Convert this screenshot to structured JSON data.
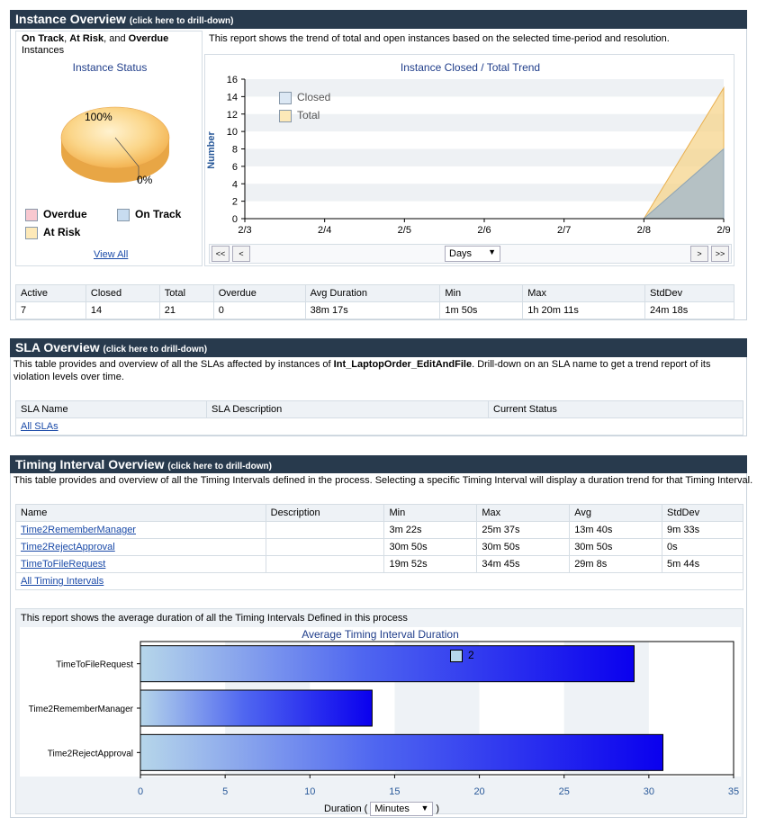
{
  "instance": {
    "header_title": "Instance Overview",
    "header_sub": "(click here to drill-down)",
    "left_title_part1": "On Track",
    "left_title_part2": ", ",
    "left_title_part3": "At Risk",
    "left_title_part4": ", and ",
    "left_title_part5": "Overdue",
    "left_title_part6": "Instances",
    "description": "This report shows the trend of total and open instances based on the selected time-period and resolution.",
    "status_chart_title": "Instance Status",
    "pie_label_100": "100%",
    "pie_label_0": "0%",
    "legend": [
      {
        "label": "Overdue",
        "color": "#f8c8d0"
      },
      {
        "label": "On Track",
        "color": "#c8dcf0"
      },
      {
        "label": "At Risk",
        "color": "#fde9b8"
      }
    ],
    "view_all": "View All",
    "trend_title": "Instance Closed / Total Trend",
    "trend_ylabel": "Number",
    "trend_legend_closed": "Closed",
    "trend_legend_total": "Total",
    "resolution": "Days",
    "nav": {
      "first": "<<",
      "prev": "<",
      "next": ">",
      "last": ">>"
    }
  },
  "chart_data": [
    {
      "type": "pie",
      "title": "Instance Status",
      "categories": [
        "Overdue",
        "On Track",
        "At Risk"
      ],
      "values": [
        0,
        0,
        100
      ],
      "labels": [
        "0%",
        "100%"
      ]
    },
    {
      "type": "area",
      "title": "Instance Closed / Total Trend",
      "ylabel": "Number",
      "x": [
        "2/3",
        "2/4",
        "2/5",
        "2/6",
        "2/7",
        "2/8",
        "2/9"
      ],
      "series": [
        {
          "name": "Closed",
          "values": [
            0,
            0,
            0,
            0,
            0,
            0,
            8
          ]
        },
        {
          "name": "Total",
          "values": [
            0,
            0,
            0,
            0,
            0,
            0,
            15
          ]
        }
      ],
      "ylim": [
        0,
        16
      ],
      "yticks": [
        0,
        2,
        4,
        6,
        8,
        10,
        12,
        14,
        16
      ],
      "legend": "top-left",
      "colors": {
        "Closed": "#a9bcc9",
        "Total": "#f6d48c"
      }
    },
    {
      "type": "bar",
      "orientation": "horizontal",
      "title": "Average Timing Interval Duration",
      "xlabel": "Duration",
      "categories": [
        "TimeToFileRequest",
        "Time2RememberManager",
        "Time2RejectApproval"
      ],
      "values": [
        29.13,
        13.67,
        30.83
      ],
      "xlim": [
        0,
        35
      ],
      "xticks": [
        0,
        5,
        10,
        15,
        20,
        25,
        30,
        35
      ],
      "legend_label": "2"
    }
  ],
  "instance_stats": {
    "headers": [
      "Active",
      "Closed",
      "Total",
      "Overdue",
      "Avg Duration",
      "Min",
      "Max",
      "StdDev"
    ],
    "values": [
      "7",
      "14",
      "21",
      "0",
      "38m 17s",
      "1m 50s",
      "1h 20m 11s",
      "24m 18s"
    ]
  },
  "sla": {
    "header_title": "SLA Overview",
    "header_sub": "(click here to drill-down)",
    "desc_part1": "This table provides and overview of all the SLAs affected by instances of ",
    "desc_process": "Int_LaptopOrder_EditAndFile",
    "desc_part2": ". Drill-down on an SLA name to get a trend report of its violation levels over time.",
    "headers": [
      "SLA Name",
      "SLA Description",
      "Current Status"
    ],
    "all_link": "All SLAs"
  },
  "timing": {
    "header_title": "Timing Interval Overview",
    "header_sub": "(click here to drill-down)",
    "description": "This table provides and overview of all the Timing Intervals defined in the process. Selecting a specific Timing Interval will display a duration trend for that Timing Interval.",
    "headers": [
      "Name",
      "Description",
      "Min",
      "Max",
      "Avg",
      "StdDev"
    ],
    "rows": [
      {
        "name": "Time2RememberManager",
        "desc": "",
        "min": "3m 22s",
        "max": "25m 37s",
        "avg": "13m 40s",
        "std": "9m 33s"
      },
      {
        "name": "Time2RejectApproval",
        "desc": "",
        "min": "30m 50s",
        "max": "30m 50s",
        "avg": "30m 50s",
        "std": "0s"
      },
      {
        "name": "TimeToFileRequest",
        "desc": "",
        "min": "19m 52s",
        "max": "34m 45s",
        "avg": "29m 8s",
        "std": "5m 44s"
      }
    ],
    "all_link": "All Timing Intervals",
    "report_desc": "This report shows the average duration of all the Timing Intervals Defined in this process",
    "chart_title": "Average Timing Interval Duration",
    "duration_label_pre": "Duration (",
    "duration_label_post": ")",
    "duration_unit": "Minutes"
  }
}
